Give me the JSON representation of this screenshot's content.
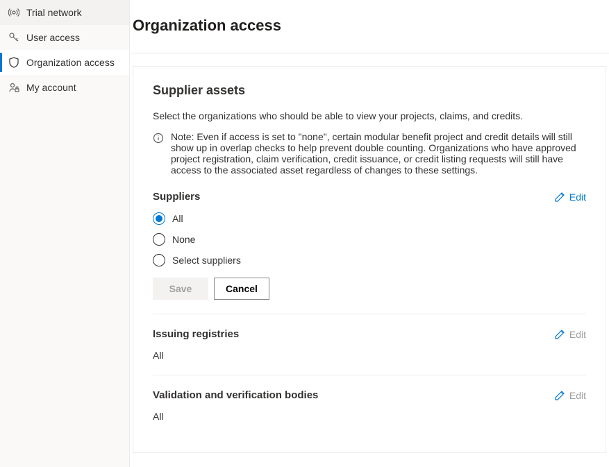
{
  "sidebar": {
    "items": [
      {
        "label": "Trial network"
      },
      {
        "label": "User access"
      },
      {
        "label": "Organization access"
      },
      {
        "label": "My account"
      }
    ]
  },
  "page": {
    "title": "Organization access"
  },
  "card": {
    "title": "Supplier assets",
    "description": "Select the organizations who should be able to view your projects, claims, and credits.",
    "note": "Note: Even if access is set to \"none\", certain modular benefit project and credit details will still show up in overlap checks to help prevent double counting. Organizations who have approved project registration, claim verification, credit issuance, or credit listing requests will still have access to the associated asset regardless of changes to these settings.",
    "sections": {
      "suppliers": {
        "title": "Suppliers",
        "edit": "Edit",
        "options": [
          {
            "label": "All"
          },
          {
            "label": "None"
          },
          {
            "label": "Select suppliers"
          }
        ],
        "save": "Save",
        "cancel": "Cancel"
      },
      "issuing": {
        "title": "Issuing registries",
        "edit": "Edit",
        "value": "All"
      },
      "vvb": {
        "title": "Validation and verification bodies",
        "edit": "Edit",
        "value": "All"
      }
    }
  }
}
